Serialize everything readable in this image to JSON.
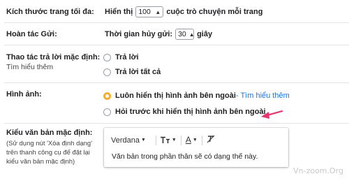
{
  "settings": {
    "page_size": {
      "label": "Kích thước trang tối đa:",
      "prefix": "Hiển thị",
      "value": "100",
      "suffix": "cuộc trò chuyện mỗi trang"
    },
    "undo_send": {
      "label": "Hoàn tác Gửi:",
      "prefix": "Thời gian hủy gửi:",
      "value": "30",
      "suffix": "giây"
    },
    "reply_behavior": {
      "label": "Thao tác trả lời mặc định:",
      "learn_more": "Tìm hiểu thêm",
      "options": [
        {
          "label": "Trả lời",
          "selected": false
        },
        {
          "label": "Trả lời tất cả",
          "selected": false
        }
      ]
    },
    "images": {
      "label": "Hình ảnh:",
      "options": [
        {
          "label": "Luôn hiển thị hình ảnh bên ngoài",
          "extra": " - Tìm hiểu thêm",
          "selected": true
        },
        {
          "label": "Hỏi trước khi hiển thị hình ảnh bên ngoài",
          "selected": false
        }
      ]
    },
    "text_style": {
      "label": "Kiểu văn bản mặc định:",
      "note_lines": [
        "(Sử dụng nút 'Xóa định dạng'",
        "trên thanh công cụ để đặt lại",
        "kiểu văn bản mặc định)"
      ],
      "font": "Verdana",
      "preview_text": "Văn bản trong phần thân sẽ có dạng thế này."
    }
  },
  "watermark": "Vn-zoom.Org",
  "colors": {
    "accent_radio": "#f6ae2d",
    "link": "#1a73e8",
    "arrow": "#e8336d"
  },
  "icons": [
    "size-icon",
    "text-color-icon",
    "clear-format-icon",
    "arrow-annotation"
  ]
}
